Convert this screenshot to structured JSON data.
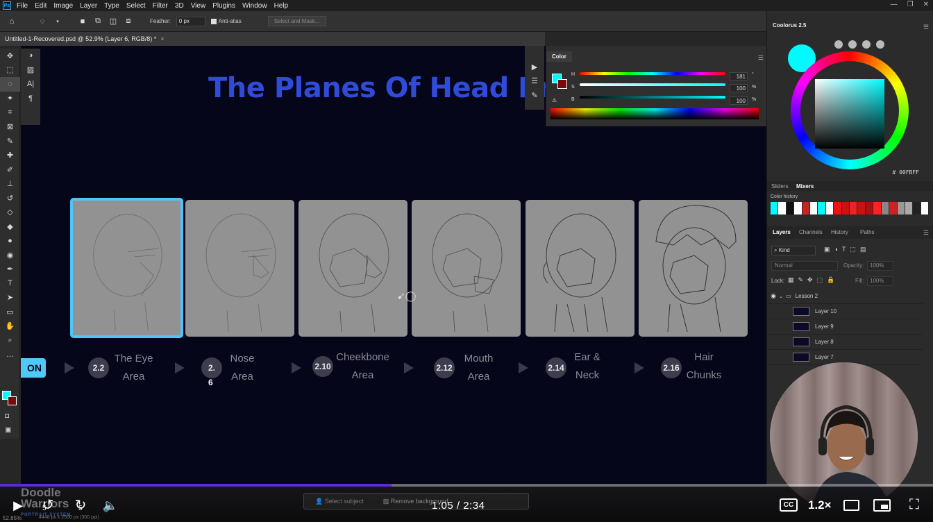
{
  "menubar": {
    "app_icon": "Ps",
    "items": [
      "File",
      "Edit",
      "Image",
      "Layer",
      "Type",
      "Select",
      "Filter",
      "3D",
      "View",
      "Plugins",
      "Window",
      "Help"
    ]
  },
  "options": {
    "feather_label": "Feather:",
    "feather_value": "0 px",
    "antialias_label": "Anti-alias",
    "select_mask_label": "Select and Mask..."
  },
  "document": {
    "tab_title": "Untitled-1-Recovered.psd @ 52.9% (Layer 6, RGB/8) *",
    "close": "×"
  },
  "canvas": {
    "title": "The Planes Of Head Pr",
    "lesson_pill": "ON",
    "steps": [
      {
        "num": "2.2",
        "line1": "The Eye",
        "line2": "Area"
      },
      {
        "num": "2.",
        "num2": "6",
        "line1": "Nose",
        "line2": "Area"
      },
      {
        "num": "2.10",
        "line1": "Cheekbone",
        "line2": "Area"
      },
      {
        "num": "2.12",
        "line1": "Mouth",
        "line2": "Area"
      },
      {
        "num": "2.14",
        "line1": "Ear &",
        "line2": "Neck"
      },
      {
        "num": "2.16",
        "line1": "Hair",
        "line2": "Chunks"
      }
    ]
  },
  "color_panel": {
    "tab": "Color",
    "h_label": "H",
    "h_value": "181",
    "h_unit": "°",
    "s_label": "S",
    "s_value": "100",
    "s_unit": "%",
    "b_label": "B",
    "b_value": "100",
    "b_unit": "%",
    "fg_color": "#00fbff",
    "bg_color": "#7a0a0a"
  },
  "coolorus": {
    "title": "Coolorus 2.5",
    "hex": "# 00FBFF",
    "tabs": [
      "Sliders",
      "Mixers"
    ],
    "history_label": "Color history",
    "history_colors": [
      "#00fbff",
      "#ffffff",
      "#111111",
      "#ffffff",
      "#cc2222",
      "#ffffff",
      "#00fbff",
      "#ffffff",
      "#ee1111",
      "#cc1111",
      "#ee2222",
      "#cc1111",
      "#aa1111",
      "#ff2222",
      "#888888",
      "#cc2222",
      "#999999",
      "#aaaaaa",
      "#222222",
      "#ffffff"
    ]
  },
  "layers_panel": {
    "tabs": [
      "Layers",
      "Channels",
      "History",
      "Paths"
    ],
    "filter_label": "Kind",
    "blend_mode": "Normal",
    "opacity_label": "Opacity:",
    "opacity_value": "100%",
    "lock_label": "Lock:",
    "fill_label": "Fill:",
    "fill_value": "100%",
    "group_name": "Lesson 2",
    "layers": [
      "Layer 10",
      "Layer 9",
      "Layer 8",
      "Layer 7"
    ]
  },
  "statusbar": {
    "zoom": "52.85%",
    "size": "4448 px x 2500 px (300 ppi)",
    "select_subject": "Select subject",
    "remove_background": "Remove background"
  },
  "watermark": {
    "line1": "Doodle",
    "line2": "Warriors",
    "line3": "PORTRAIT SYSTEM"
  },
  "player": {
    "current_time": "1:05",
    "separator": "/",
    "duration": "2:34",
    "progress": 0.42,
    "rewind_seconds": "5",
    "forward_seconds": "5",
    "speed": "1.2×",
    "cc": "CC"
  }
}
